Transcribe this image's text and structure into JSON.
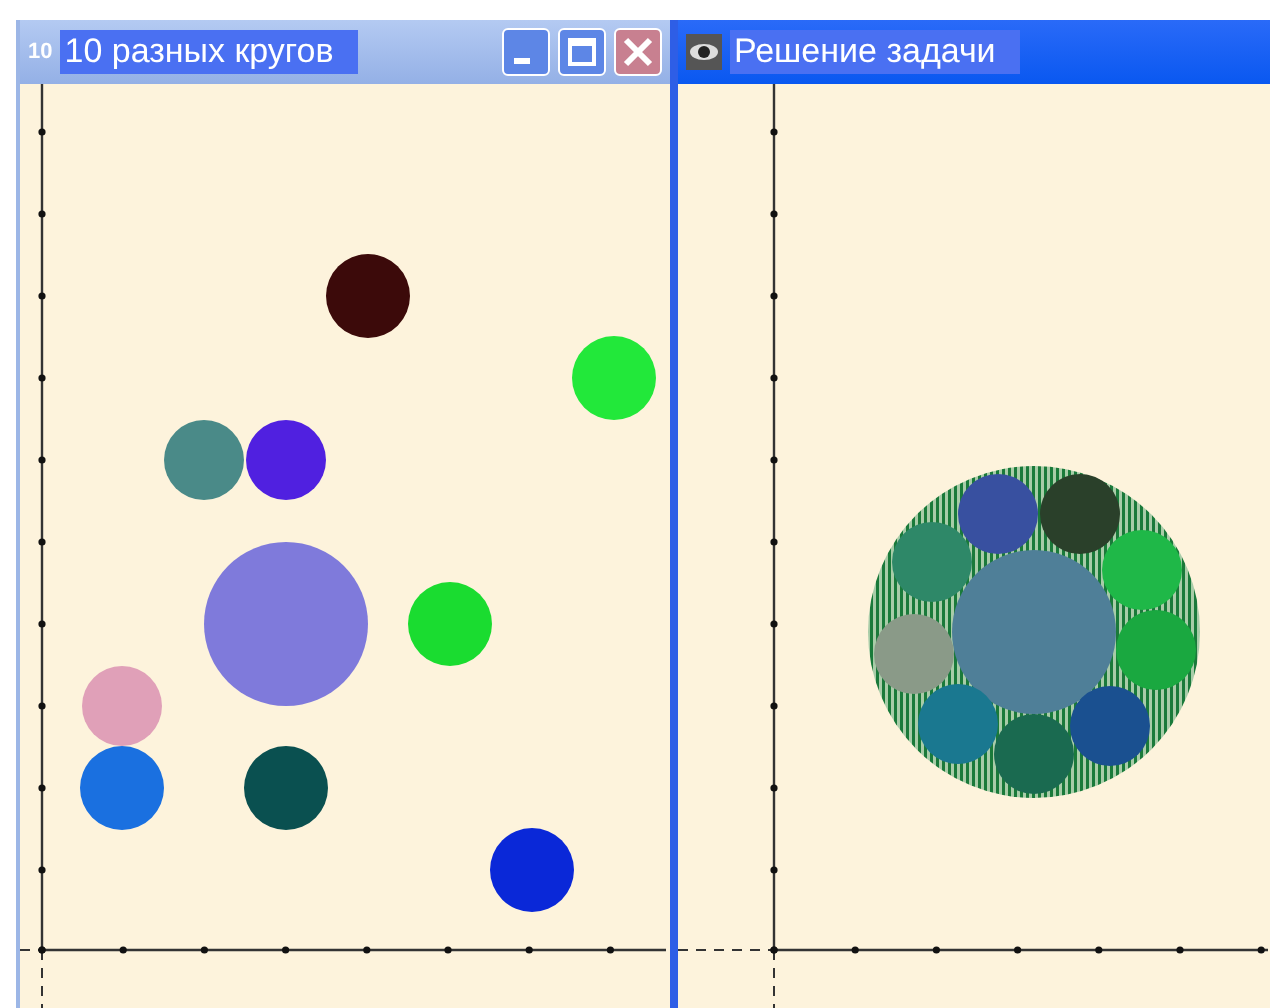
{
  "windows": [
    {
      "title": "10 разных кругов",
      "icon_text": "10",
      "active": false,
      "buttons": [
        {
          "kind": "minimize"
        },
        {
          "kind": "maximize"
        },
        {
          "kind": "close"
        }
      ],
      "circles": [
        {
          "color": "#3c0a0a"
        },
        {
          "color": "#22e83a"
        },
        {
          "color": "#4a8a88"
        },
        {
          "color": "#5020e0"
        },
        {
          "color": "#7f7adb"
        },
        {
          "color": "#1adc30"
        },
        {
          "color": "#e0a0b8"
        },
        {
          "color": "#1a70e0"
        },
        {
          "color": "#0a5050"
        },
        {
          "color": "#0a28d8"
        }
      ]
    },
    {
      "title": "Решение задачи",
      "active": true,
      "circles": [
        {
          "color": "#4f7f98"
        },
        {
          "color": "#3850a0"
        },
        {
          "color": "#2a402a"
        },
        {
          "color": "#1fb848"
        },
        {
          "color": "#1aa840"
        },
        {
          "color": "#1a5090"
        },
        {
          "color": "#1a6a50"
        },
        {
          "color": "#1a7890"
        },
        {
          "color": "#8a9a88"
        },
        {
          "color": "#2e8868"
        }
      ]
    }
  ]
}
